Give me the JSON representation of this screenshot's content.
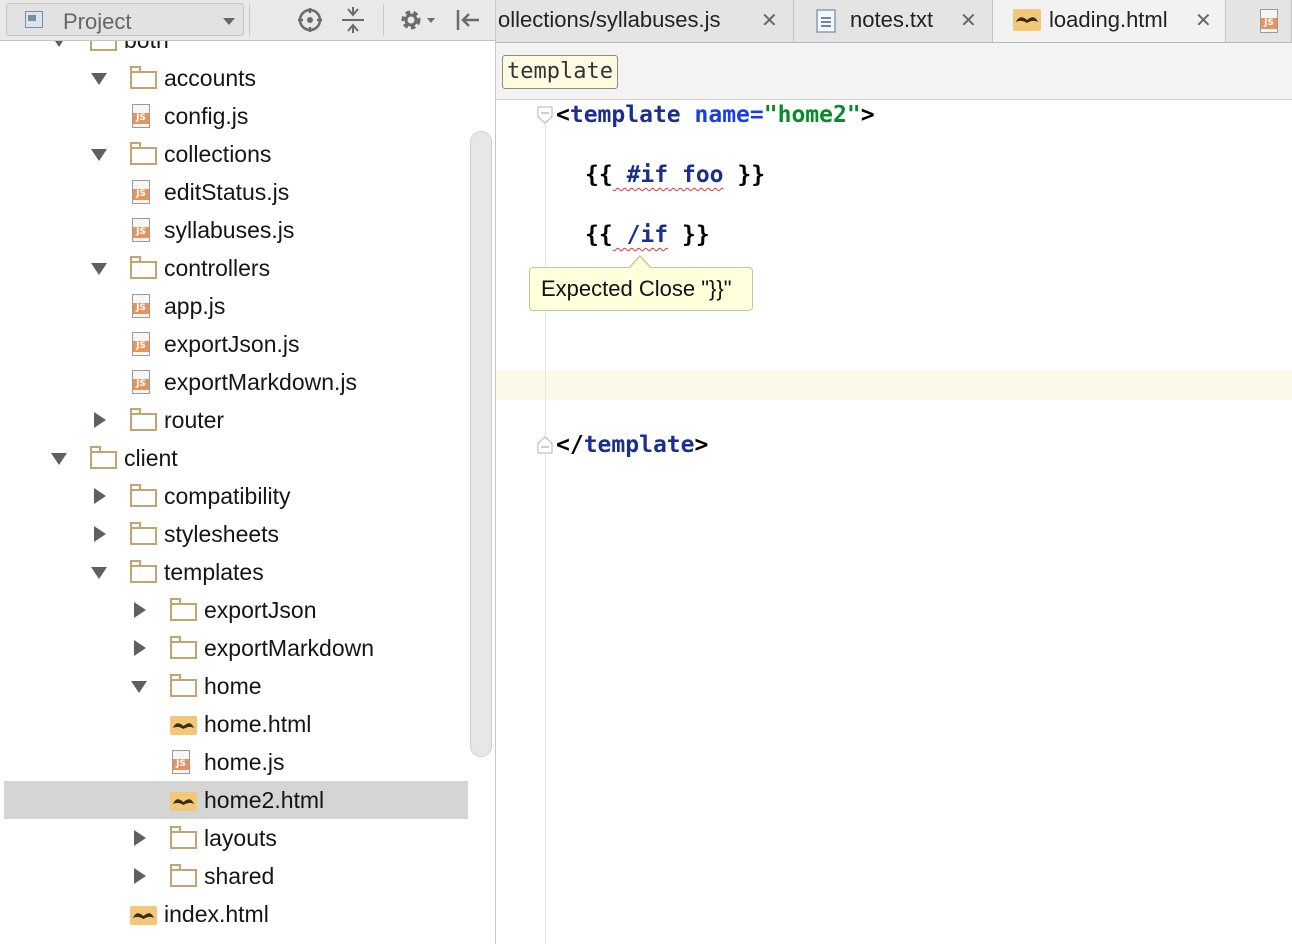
{
  "project_panel": {
    "view_label": "Project",
    "toolbar": [
      "locate-icon",
      "collapse-all-icon",
      "settings-icon",
      "hide-panel-icon"
    ],
    "tree": [
      {
        "label": "both",
        "type": "folder",
        "expanded": true
      },
      {
        "label": "accounts",
        "type": "folder",
        "expanded": true
      },
      {
        "label": "config.js",
        "type": "js"
      },
      {
        "label": "collections",
        "type": "folder",
        "expanded": true
      },
      {
        "label": "editStatus.js",
        "type": "js"
      },
      {
        "label": "syllabuses.js",
        "type": "js"
      },
      {
        "label": "controllers",
        "type": "folder",
        "expanded": true
      },
      {
        "label": "app.js",
        "type": "js"
      },
      {
        "label": "exportJson.js",
        "type": "js"
      },
      {
        "label": "exportMarkdown.js",
        "type": "js"
      },
      {
        "label": "router",
        "type": "folder",
        "expanded": false
      },
      {
        "label": "client",
        "type": "folder",
        "expanded": true
      },
      {
        "label": "compatibility",
        "type": "folder",
        "expanded": false
      },
      {
        "label": "stylesheets",
        "type": "folder",
        "expanded": false
      },
      {
        "label": "templates",
        "type": "folder",
        "expanded": true
      },
      {
        "label": "exportJson",
        "type": "folder",
        "expanded": false
      },
      {
        "label": "exportMarkdown",
        "type": "folder",
        "expanded": false
      },
      {
        "label": "home",
        "type": "folder",
        "expanded": true
      },
      {
        "label": "home.html",
        "type": "html"
      },
      {
        "label": "home.js",
        "type": "js"
      },
      {
        "label": "home2.html",
        "type": "html",
        "selected": true
      },
      {
        "label": "layouts",
        "type": "folder",
        "expanded": false
      },
      {
        "label": "shared",
        "type": "folder",
        "expanded": false
      },
      {
        "label": "index.html",
        "type": "html"
      }
    ]
  },
  "editor": {
    "tabs": [
      {
        "label": "ollections/syllabuses.js",
        "icon": "js",
        "close": "✕"
      },
      {
        "label": "notes.txt",
        "icon": "text-file-icon",
        "close": "✕"
      },
      {
        "label": "loading.html",
        "icon": "html",
        "close": "✕"
      },
      {
        "label": "",
        "icon": "js",
        "close": ""
      }
    ],
    "breadcrumb": "template",
    "code": {
      "open_tag_bracket": "<",
      "tag_name": "template",
      "attr_name": "name",
      "equals": "=",
      "attr_value": "\"home2\"",
      "close_bracket": ">",
      "if_open_prefix": "{{",
      "if_keyword": "#if",
      "if_arg": "foo",
      "if_suffix": "}}",
      "endif_prefix": "{{",
      "endif_keyword": "/if",
      "endif_suffix": "}}",
      "end_tag_open": "</",
      "end_tag_name": "template",
      "end_tag_close": ">"
    },
    "tooltip": "Expected Close \"}}\""
  },
  "colors": {
    "tag": "#1b2f8f",
    "attribute": "#1c3ee0",
    "string": "#0b8a2c",
    "error_squiggle": "#e03333",
    "tooltip_bg": "#ffffdc",
    "selection": "#d5d5d5",
    "caret_line": "#fdf9e9"
  }
}
